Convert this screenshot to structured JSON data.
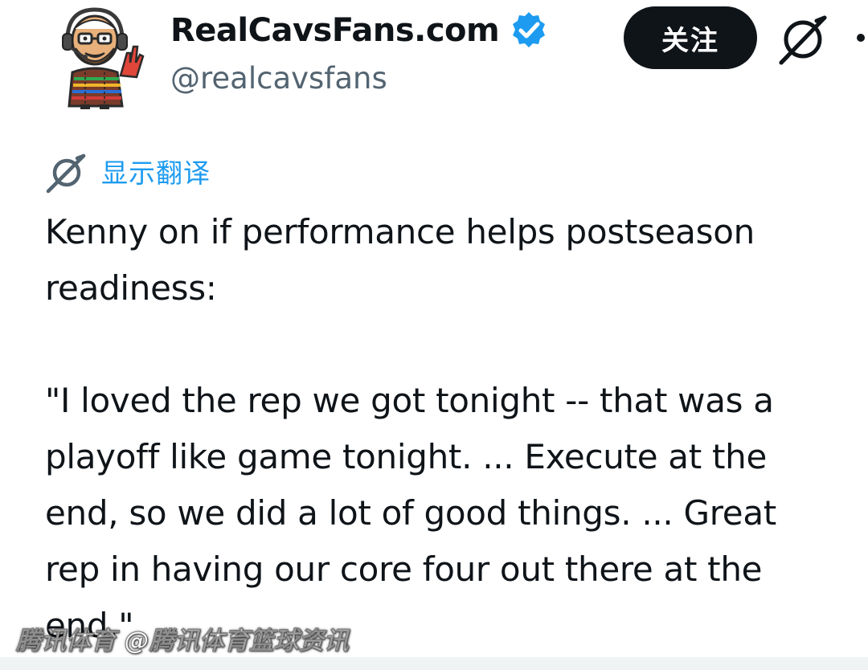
{
  "author": {
    "display_name": "RealCavsFans.com",
    "handle": "@realcavsfans",
    "verified": true,
    "avatar_icon": "cartoon-fan-avatar"
  },
  "actions": {
    "follow_label": "关注",
    "grok_icon": "grok-icon",
    "more_icon": "more-icon"
  },
  "translate": {
    "label": "显示翻译",
    "icon": "grok-icon"
  },
  "tweet": {
    "lines": [
      "Kenny on if performance helps postseason",
      "readiness:",
      "\"I loved the rep we got tonight -- that was a",
      "playoff like game tonight. ... Execute at the",
      "end, so we did a lot of good things. ... Great",
      "rep in having our core four out there at the",
      "end.\""
    ]
  },
  "watermark": {
    "text": "腾讯体育 @腾讯体育篮球资讯"
  },
  "colors": {
    "text_primary": "#0f1419",
    "text_secondary": "#536471",
    "accent_blue": "#1d9bf0",
    "follow_bg": "#0f1419",
    "follow_text": "#ffffff"
  }
}
